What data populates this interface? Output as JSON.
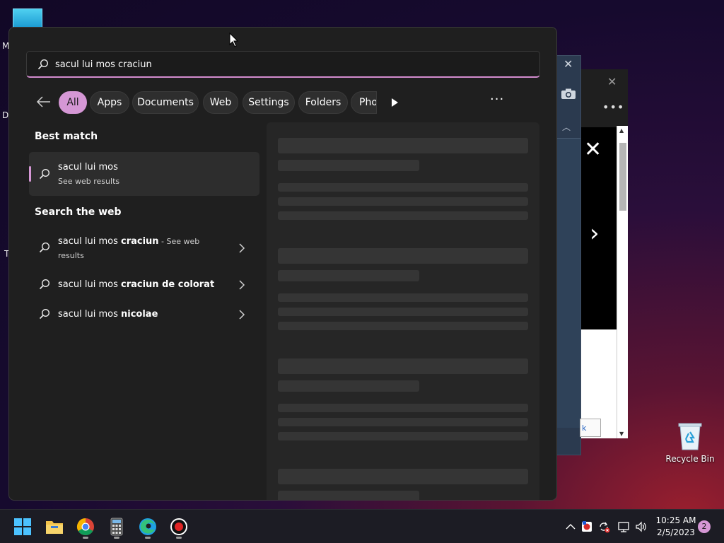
{
  "desktop": {
    "left_letters": [
      "M",
      "Da",
      "T"
    ],
    "recycle_bin_label": "Recycle Bin"
  },
  "search": {
    "query": "sacul lui mos craciun"
  },
  "filters": {
    "chips": [
      "All",
      "Apps",
      "Documents",
      "Web",
      "Settings",
      "Folders",
      "Phot"
    ]
  },
  "results": {
    "best_match_title": "Best match",
    "best_match": {
      "title": "sacul lui mos",
      "subtitle": "See web results"
    },
    "web_title": "Search the web",
    "web_items": [
      {
        "prefix": "sacul lui mos ",
        "bold": "craciun",
        "suffix": " - See web",
        "sub": "results"
      },
      {
        "prefix": "sacul lui mos ",
        "bold": "craciun de colorat",
        "suffix": "",
        "sub": ""
      },
      {
        "prefix": "sacul lui mos ",
        "bold": "nicolae",
        "suffix": "",
        "sub": ""
      }
    ]
  },
  "background_window": {
    "button_text": "k"
  },
  "taskbar": {
    "time": "10:25 AM",
    "date": "2/5/2023",
    "notification_count": "2"
  },
  "colors": {
    "accent": "#d597d5",
    "panel_bg": "#1f1f1f",
    "taskbar_bg": "#1c1c24"
  }
}
